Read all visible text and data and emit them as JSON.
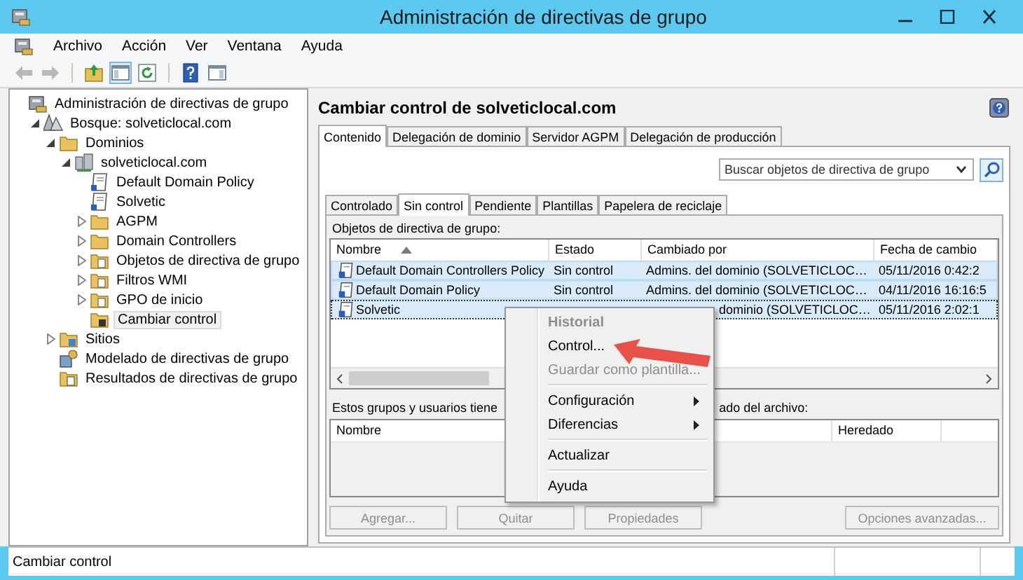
{
  "window": {
    "title": "Administración de directivas de grupo"
  },
  "menu": [
    {
      "label": "Archivo"
    },
    {
      "label": "Acción"
    },
    {
      "label": "Ver"
    },
    {
      "label": "Ventana"
    },
    {
      "label": "Ayuda"
    }
  ],
  "toolbar": [
    {
      "kind": "back",
      "disabled": true,
      "on": false
    },
    {
      "kind": "forward",
      "disabled": true,
      "on": false
    },
    {
      "kind": "up",
      "disabled": false,
      "on": false
    },
    {
      "kind": "tree",
      "disabled": false,
      "on": true
    },
    {
      "kind": "refresh",
      "disabled": false,
      "on": false
    },
    {
      "kind": "help",
      "disabled": false,
      "on": false
    },
    {
      "kind": "panel",
      "disabled": false,
      "on": false
    }
  ],
  "tree": [
    {
      "label": "Administración de directivas de grupo",
      "kind": "root",
      "selected": false,
      "children": [
        {
          "label": "Bosque: solveticlocal.com",
          "kind": "forest",
          "expanded": true,
          "selected": false,
          "children": [
            {
              "label": "Dominios",
              "kind": "folder",
              "expanded": true,
              "selected": false,
              "children": [
                {
                  "label": "solveticlocal.com",
                  "kind": "domain",
                  "expanded": true,
                  "selected": false,
                  "children": [
                    {
                      "label": "Default Domain Policy",
                      "kind": "gpo",
                      "selected": false
                    },
                    {
                      "label": "Solvetic",
                      "kind": "gpo",
                      "selected": false
                    },
                    {
                      "label": "AGPM",
                      "kind": "folder",
                      "expanded": false,
                      "selected": false
                    },
                    {
                      "label": "Domain Controllers",
                      "kind": "folder",
                      "expanded": false,
                      "selected": false
                    },
                    {
                      "label": "Objetos de directiva de grupo",
                      "kind": "gpo-folder",
                      "expanded": false,
                      "selected": false
                    },
                    {
                      "label": "Filtros WMI",
                      "kind": "wmi-folder",
                      "expanded": false,
                      "selected": false
                    },
                    {
                      "label": "GPO de inicio",
                      "kind": "starter-folder",
                      "expanded": false,
                      "selected": false
                    },
                    {
                      "label": "Cambiar control",
                      "kind": "lock-folder",
                      "selected": true
                    }
                  ]
                }
              ]
            },
            {
              "label": "Sitios",
              "kind": "sites",
              "expanded": false,
              "selected": false
            },
            {
              "label": "Modelado de directivas de grupo",
              "kind": "modeling",
              "selected": false
            },
            {
              "label": "Resultados de directivas de grupo",
              "kind": "results",
              "selected": false
            }
          ]
        }
      ]
    }
  ],
  "panel": {
    "title": "Cambiar control de solveticlocal.com",
    "tabs": [
      {
        "label": "Contenido",
        "selected": true
      },
      {
        "label": "Delegación de dominio",
        "selected": false
      },
      {
        "label": "Servidor AGPM",
        "selected": false
      },
      {
        "label": "Delegación de producción",
        "selected": false
      }
    ],
    "search": {
      "placeholder": "Buscar objetos de directiva de grupo"
    },
    "subtabs": [
      {
        "label": "Controlado",
        "selected": false
      },
      {
        "label": "Sin control",
        "selected": true
      },
      {
        "label": "Pendiente",
        "selected": false
      },
      {
        "label": "Plantillas",
        "selected": false
      },
      {
        "label": "Papelera de reciclaje",
        "selected": false
      }
    ],
    "gpo_label": "Objetos de directiva de grupo:",
    "gpo_table": {
      "columns": [
        {
          "label": "Nombre",
          "sorted": true
        },
        {
          "label": "Estado",
          "sorted": false
        },
        {
          "label": "Cambiado por",
          "sorted": false
        },
        {
          "label": "Fecha de cambio",
          "sorted": false
        }
      ],
      "rows": [
        {
          "name": "Default Domain Controllers Policy",
          "status": "Sin control",
          "changed_by": "Admins. del dominio (SOLVETICLOC…",
          "date": "05/11/2016 0:42:2",
          "selected": true,
          "focused": false,
          "covered": false
        },
        {
          "name": "Default Domain Policy",
          "status": "Sin control",
          "changed_by": "Admins. del dominio (SOLVETICLOC…",
          "date": "04/11/2016 16:16:5",
          "selected": true,
          "focused": false,
          "covered": false
        },
        {
          "name": "Solvetic",
          "changed_by": "dominio (SOLVETICLOC…",
          "date": "05/11/2016 2:02:1",
          "selected": true,
          "focused": true,
          "covered": true
        }
      ]
    },
    "perm_label_parts": [
      "Estos grupos y usuarios tiene",
      "ado del archivo:"
    ],
    "perm_table": {
      "columns": [
        {
          "label": "Nombre"
        },
        {
          "label": "Heredado"
        }
      ]
    },
    "buttons": [
      {
        "label": "Agregar...",
        "disabled": true
      },
      {
        "label": "Quitar",
        "disabled": true
      },
      {
        "label": "Propiedades",
        "disabled": true
      },
      {
        "label": "Opciones avanzadas...",
        "disabled": true
      }
    ]
  },
  "context_menu": [
    {
      "kind": "header",
      "label": "Historial",
      "disabled": true,
      "submenu": false
    },
    {
      "kind": "item",
      "label": "Control...",
      "disabled": false,
      "submenu": false
    },
    {
      "kind": "item",
      "label": "Guardar como plantilla...",
      "disabled": true,
      "submenu": false
    },
    {
      "kind": "separator"
    },
    {
      "kind": "item",
      "label": "Configuración",
      "disabled": false,
      "submenu": true
    },
    {
      "kind": "item",
      "label": "Diferencias",
      "disabled": false,
      "submenu": true
    },
    {
      "kind": "separator"
    },
    {
      "kind": "item",
      "label": "Actualizar",
      "disabled": false,
      "submenu": false
    },
    {
      "kind": "separator"
    },
    {
      "kind": "item",
      "label": "Ayuda",
      "disabled": false,
      "submenu": false
    }
  ],
  "status_bar": {
    "text": "Cambiar control"
  }
}
